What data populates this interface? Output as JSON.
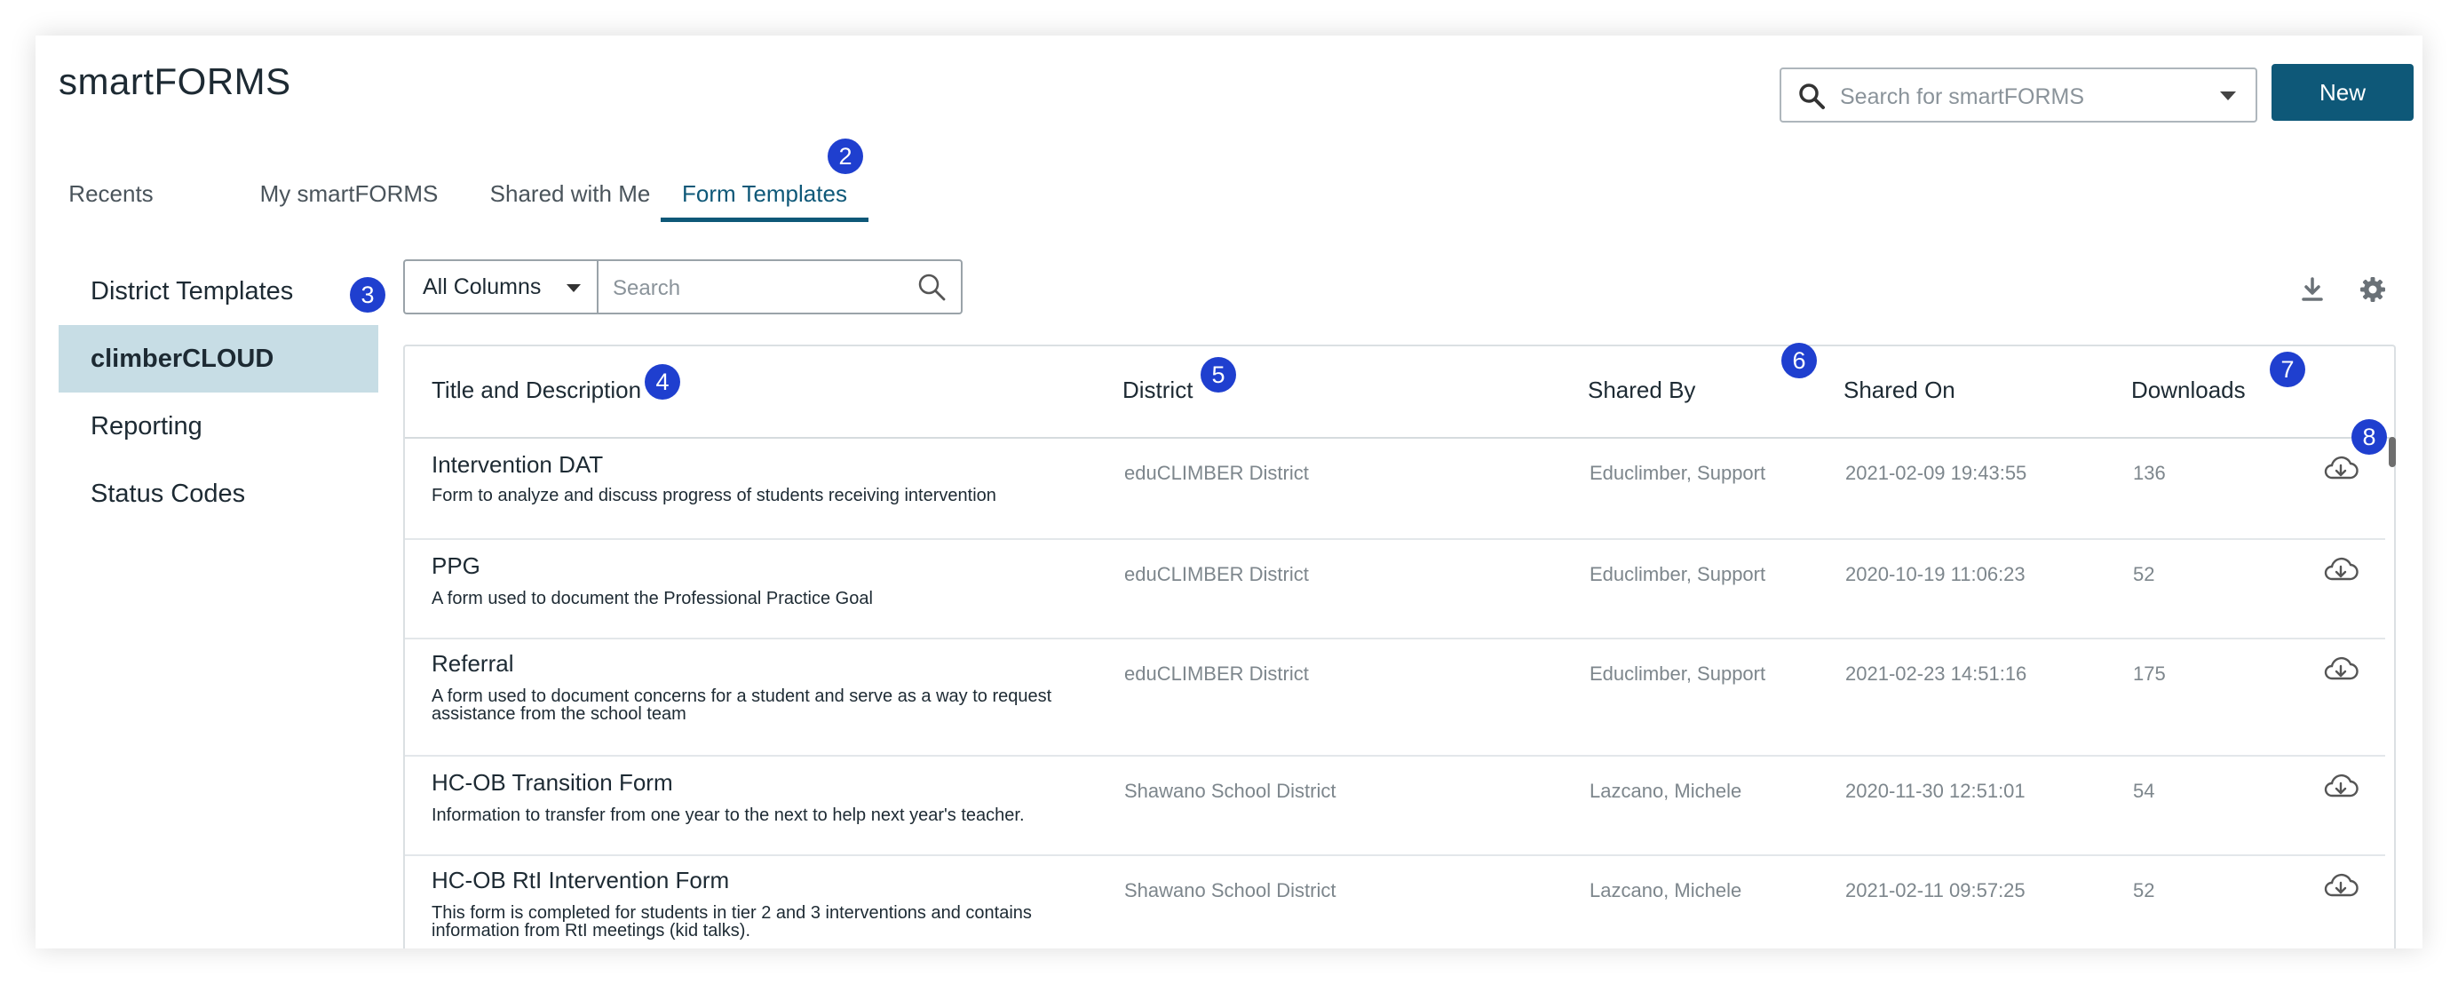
{
  "header": {
    "app_title": "smartFORMS",
    "search_placeholder": "Search for smartFORMS",
    "new_button": "New"
  },
  "tabs": [
    {
      "label": "Recents",
      "active": false
    },
    {
      "label": "My smartFORMS",
      "active": false
    },
    {
      "label": "Shared with Me",
      "active": false
    },
    {
      "label": "Form Templates",
      "active": true
    }
  ],
  "sidebar": {
    "items": [
      {
        "label": "District Templates",
        "active": false
      },
      {
        "label": "climberCLOUD",
        "active": true
      },
      {
        "label": "Reporting",
        "active": false
      },
      {
        "label": "Status Codes",
        "active": false
      }
    ]
  },
  "filter": {
    "column_select": "All Columns",
    "search_placeholder": "Search"
  },
  "table": {
    "columns": [
      "Title and Description",
      "District",
      "Shared By",
      "Shared On",
      "Downloads"
    ],
    "rows": [
      {
        "title": "Intervention DAT",
        "description": "Form to analyze and discuss progress of students receiving intervention",
        "district": "eduCLIMBER District",
        "shared_by": "Educlimber, Support",
        "shared_on": "2021-02-09 19:43:55",
        "downloads": "136"
      },
      {
        "title": "PPG",
        "description": "A form used to document the Professional Practice Goal",
        "district": "eduCLIMBER District",
        "shared_by": "Educlimber, Support",
        "shared_on": "2020-10-19 11:06:23",
        "downloads": "52"
      },
      {
        "title": "Referral",
        "description": "A form used to document concerns for a student and serve as a way to request assistance from the school team",
        "district": "eduCLIMBER District",
        "shared_by": "Educlimber, Support",
        "shared_on": "2021-02-23 14:51:16",
        "downloads": "175"
      },
      {
        "title": "HC-OB Transition Form",
        "description": "Information to transfer from one year to the next to help next year's teacher.",
        "district": "Shawano School District",
        "shared_by": "Lazcano, Michele",
        "shared_on": "2020-11-30 12:51:01",
        "downloads": "54"
      },
      {
        "title": "HC-OB RtI Intervention Form",
        "description": "This form is completed for students in tier 2 and 3 interventions and contains information from RtI meetings (kid talks).",
        "district": "Shawano School District",
        "shared_by": "Lazcano, Michele",
        "shared_on": "2021-02-11 09:57:25",
        "downloads": "52"
      }
    ]
  },
  "badges": [
    "2",
    "3",
    "4",
    "5",
    "6",
    "7",
    "8"
  ],
  "colors": {
    "brand": "#0e5878",
    "badge": "#1f3fcf",
    "active_sidebar": "#c7dde5"
  }
}
